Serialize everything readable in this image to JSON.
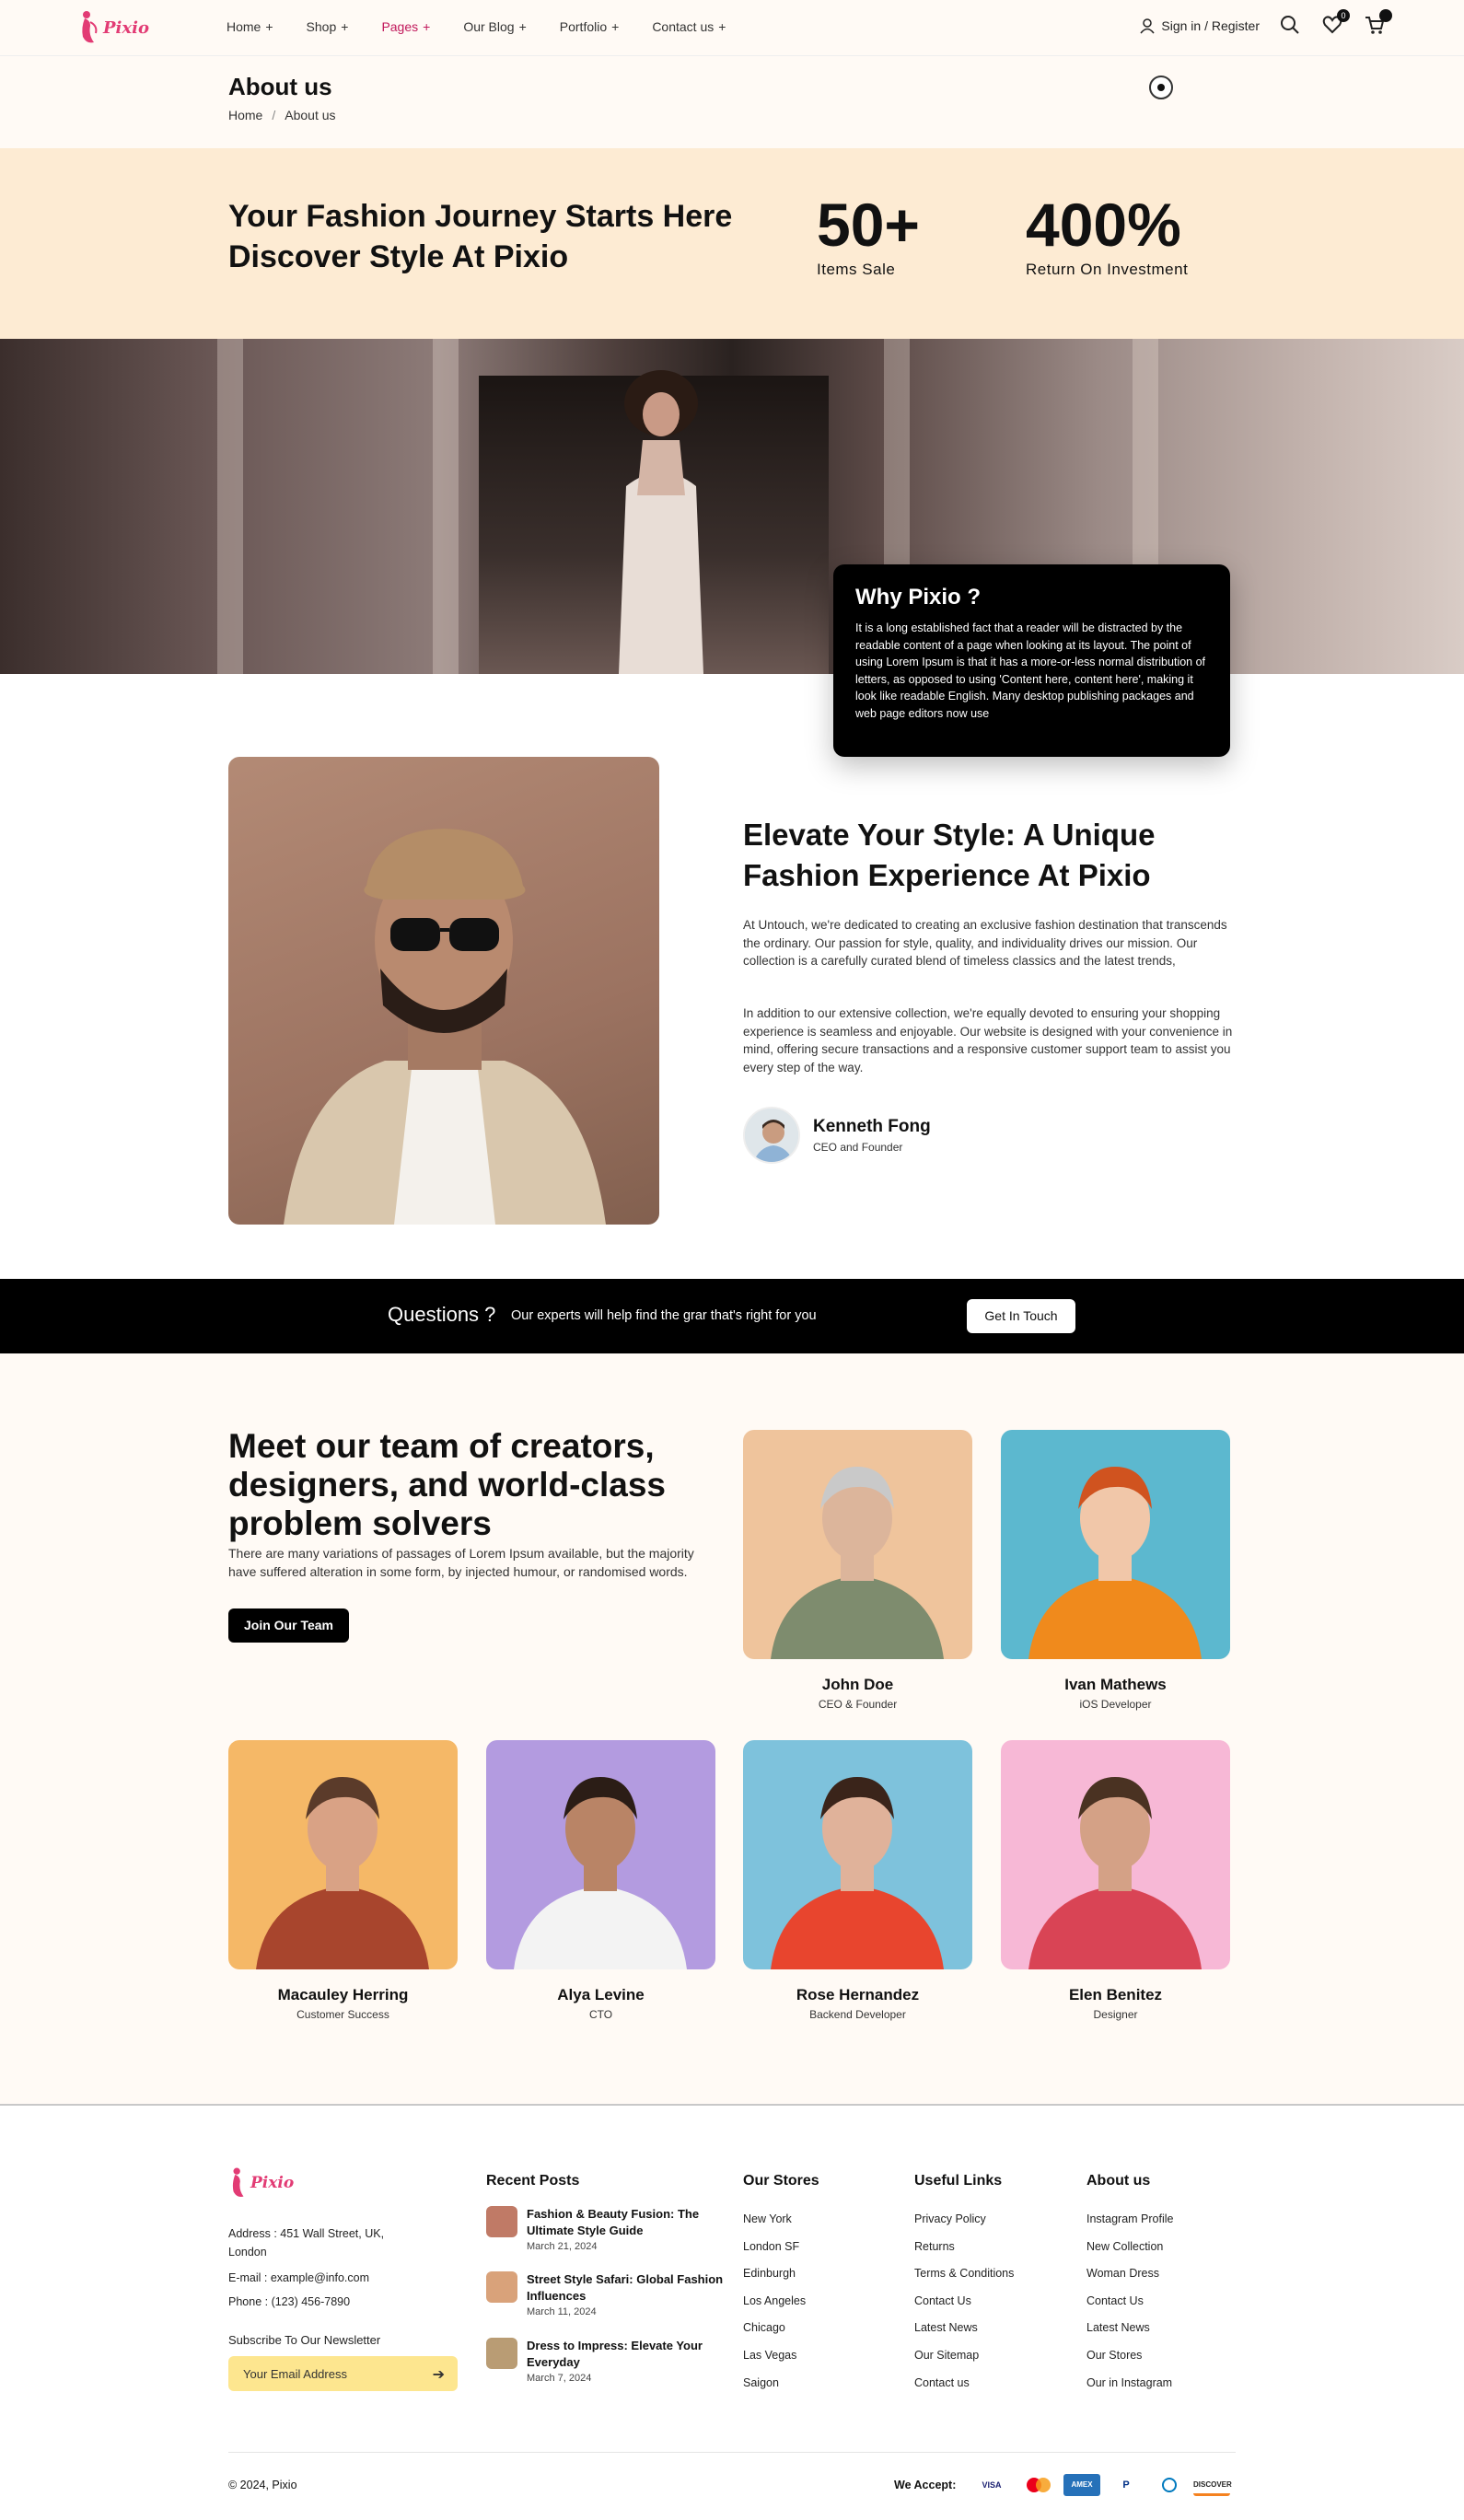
{
  "brand": {
    "name": "Pixio",
    "color": "#e23b74"
  },
  "nav": {
    "items": [
      {
        "label": "Home",
        "active": false
      },
      {
        "label": "Shop",
        "active": false
      },
      {
        "label": "Pages",
        "active": true
      },
      {
        "label": "Our Blog",
        "active": false
      },
      {
        "label": "Portfolio",
        "active": false
      },
      {
        "label": "Contact us",
        "active": false
      }
    ],
    "plus": "+",
    "signin": "Sign in / Register",
    "wishlist_count": "0",
    "cart_count": ""
  },
  "page": {
    "title": "About us",
    "breadcrumb": [
      "Home",
      "/",
      "About us"
    ]
  },
  "stats": {
    "headline_line1": "Your Fashion Journey Starts Here",
    "headline_line2": "Discover Style At Pixio",
    "items": [
      {
        "value": "50+",
        "label": "Items Sale"
      },
      {
        "value": "400%",
        "label": "Return On Investment"
      }
    ]
  },
  "why": {
    "title": "Why Pixio ?",
    "text": "It is a long established fact that a reader will be distracted by the readable content of a page when looking at its layout. The point of using Lorem Ipsum is that it has a more-or-less normal distribution of letters, as opposed to using 'Content here, content here', making it look like readable English. Many desktop publishing packages and web page editors now use"
  },
  "about": {
    "heading": "Elevate Your Style: A Unique Fashion Experience At Pixio",
    "para1": "At Untouch, we're dedicated to creating an exclusive fashion destination that transcends the ordinary. Our passion for style, quality, and individuality drives our mission. Our collection is a carefully curated blend of timeless classics and the latest trends,",
    "para2": "In addition to our extensive collection, we're equally devoted to ensuring your shopping experience is seamless and enjoyable. Our website is designed with your convenience in mind, offering secure transactions and a responsive customer support team to assist you every step of the way.",
    "ceo_name": "Kenneth Fong",
    "ceo_role": "CEO and Founder"
  },
  "questions": {
    "title": "Questions ?",
    "subtitle": "Our experts will help find the grar that's right for you",
    "button": "Get In Touch"
  },
  "team": {
    "heading": "Meet our team of creators, designers, and world-class problem solvers",
    "text": "There are many variations of passages of Lorem Ipsum available, but the majority have suffered alteration in some form, by injected humour, or randomised words.",
    "button": "Join Our Team",
    "members": [
      {
        "name": "John Doe",
        "role": "CEO & Founder",
        "bg": "#efc49c"
      },
      {
        "name": "Ivan Mathews",
        "role": "iOS Developer",
        "bg": "#5cb8cf"
      },
      {
        "name": "Macauley Herring",
        "role": "Customer Success",
        "bg": "#f5b867"
      },
      {
        "name": "Alya Levine",
        "role": "CTO",
        "bg": "#b39be0"
      },
      {
        "name": "Rose Hernandez",
        "role": "Backend Developer",
        "bg": "#7ec2dc"
      },
      {
        "name": "Elen Benitez",
        "role": "Designer",
        "bg": "#f7b8d6"
      }
    ]
  },
  "footer": {
    "address": "Address : 451 Wall Street, UK, London",
    "email": "E-mail : example@info.com",
    "phone": "Phone : (123) 456-7890",
    "newsletter_label": "Subscribe To Our Newsletter",
    "newsletter_placeholder": "Your Email Address",
    "recent_posts_title": "Recent Posts",
    "posts": [
      {
        "title": "Fashion & Beauty Fusion: The Ultimate Style Guide",
        "date": "March 21, 2024"
      },
      {
        "title": "Street Style Safari: Global Fashion Influences",
        "date": "March 11, 2024"
      },
      {
        "title": "Dress to Impress: Elevate Your Everyday",
        "date": "March 7, 2024"
      }
    ],
    "stores_title": "Our Stores",
    "stores": [
      "New York",
      "London SF",
      "Edinburgh",
      "Los Angeles",
      "Chicago",
      "Las Vegas",
      "Saigon"
    ],
    "useful_title": "Useful Links",
    "useful": [
      "Privacy Policy",
      "Returns",
      "Terms & Conditions",
      "Contact Us",
      "Latest News",
      "Our Sitemap",
      "Contact us"
    ],
    "about_title": "About us",
    "about_links": [
      "Instagram Profile",
      "New Collection",
      "Woman Dress",
      "Contact Us",
      "Latest News",
      "Our Stores",
      "Our in Instagram"
    ],
    "copyright": "© 2024, Pixio",
    "accept_label": "We Accept:",
    "payments": [
      "VISA",
      "mastercard",
      "AMEX",
      "PayPal",
      "Diners",
      "DISCOVER"
    ]
  }
}
